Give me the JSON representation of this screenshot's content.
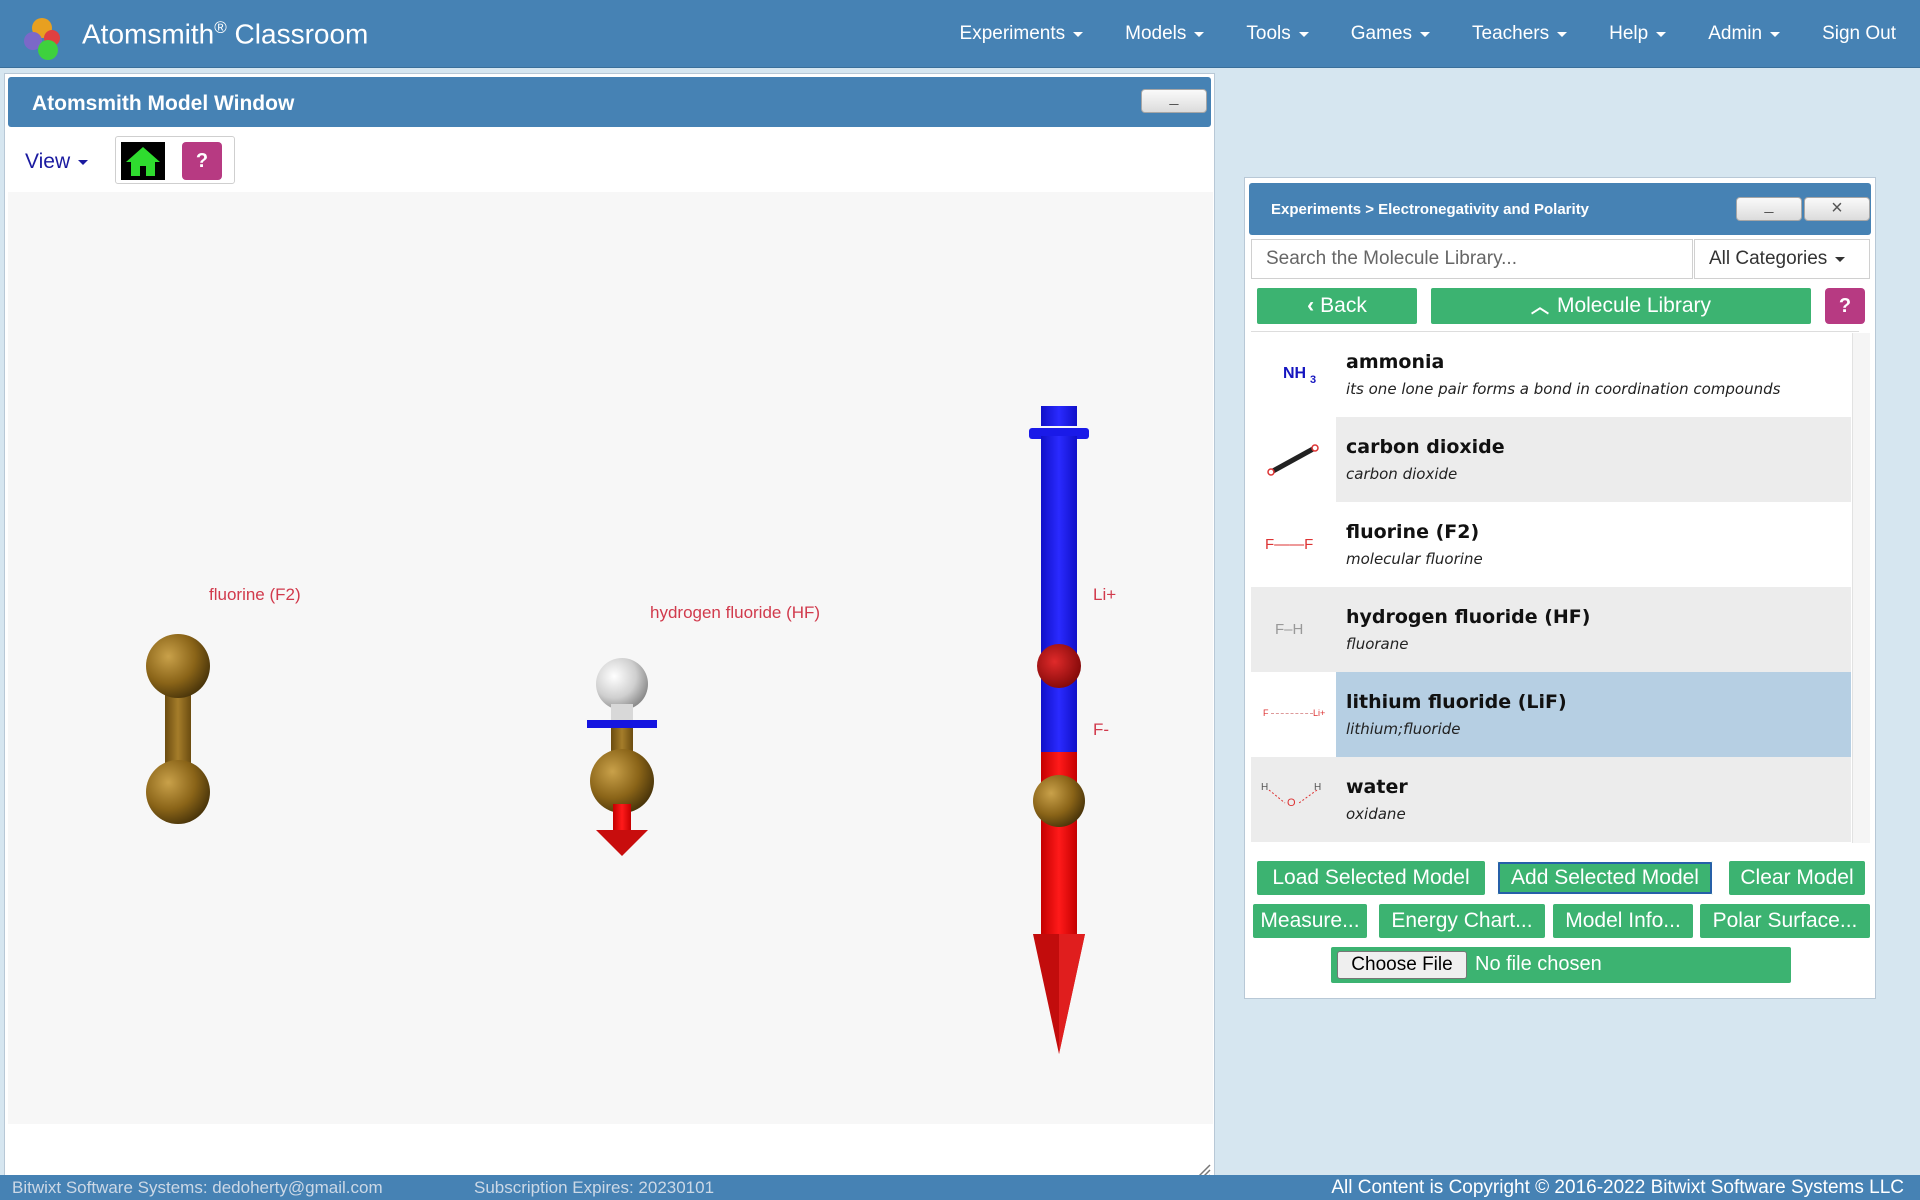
{
  "app": {
    "brand": "Atomsmith",
    "brand_reg": "®",
    "brand_suffix": " Classroom"
  },
  "nav": [
    "Experiments",
    "Models",
    "Tools",
    "Games",
    "Teachers",
    "Help",
    "Admin",
    "Sign Out"
  ],
  "model_window": {
    "title": "Atomsmith Model Window",
    "minimize": "_",
    "view_menu": "View",
    "help": "?"
  },
  "scene": {
    "labels": [
      "fluorine (F2)",
      "hydrogen fluoride (HF)",
      "Li+",
      "F-"
    ]
  },
  "library": {
    "breadcrumb": "Experiments > Electronegativity and Polarity",
    "minimize": "_",
    "close": "×",
    "search_placeholder": "Search the Molecule Library...",
    "category": "All Categories",
    "back": "Back",
    "library_label": "Molecule Library",
    "help": "?",
    "molecules": [
      {
        "name": "ammonia",
        "desc": "its one lone pair forms a bond in coordination compounds"
      },
      {
        "name": "carbon dioxide",
        "desc": "carbon dioxide"
      },
      {
        "name": "fluorine (F2)",
        "desc": "molecular fluorine"
      },
      {
        "name": "hydrogen fluoride (HF)",
        "desc": "fluorane"
      },
      {
        "name": "lithium fluoride (LiF)",
        "desc": "lithium;fluoride"
      },
      {
        "name": "water",
        "desc": "oxidane"
      }
    ],
    "selected_index": 4,
    "thumbs": {
      "ammonia_main": "NH",
      "ammonia_sub": "3",
      "f2": "F——F",
      "hf": "F–H",
      "lif_f": "F",
      "lif_li": "Li+",
      "water_h1": "H",
      "water_o": "O",
      "water_h2": "H"
    },
    "buttons": {
      "load": "Load Selected Model",
      "add": "Add Selected Model",
      "clear": "Clear Model",
      "measure": "Measure...",
      "energy": "Energy Chart...",
      "info": "Model Info...",
      "polar": "Polar Surface..."
    },
    "file": {
      "choose": "Choose File",
      "none": "No file chosen"
    }
  },
  "footer": {
    "left": "Bitwixt Software Systems: dedoherty@gmail.com",
    "middle": "Subscription Expires: 20230101",
    "right": "All Content is Copyright © 2016-2022 Bitwixt Software Systems LLC"
  },
  "colors": {
    "header": "#4682b4",
    "button_green": "#3cb371",
    "help_magenta": "#b73a82",
    "selected_row": "#b6cfe3",
    "background": "#d6e6f0"
  }
}
